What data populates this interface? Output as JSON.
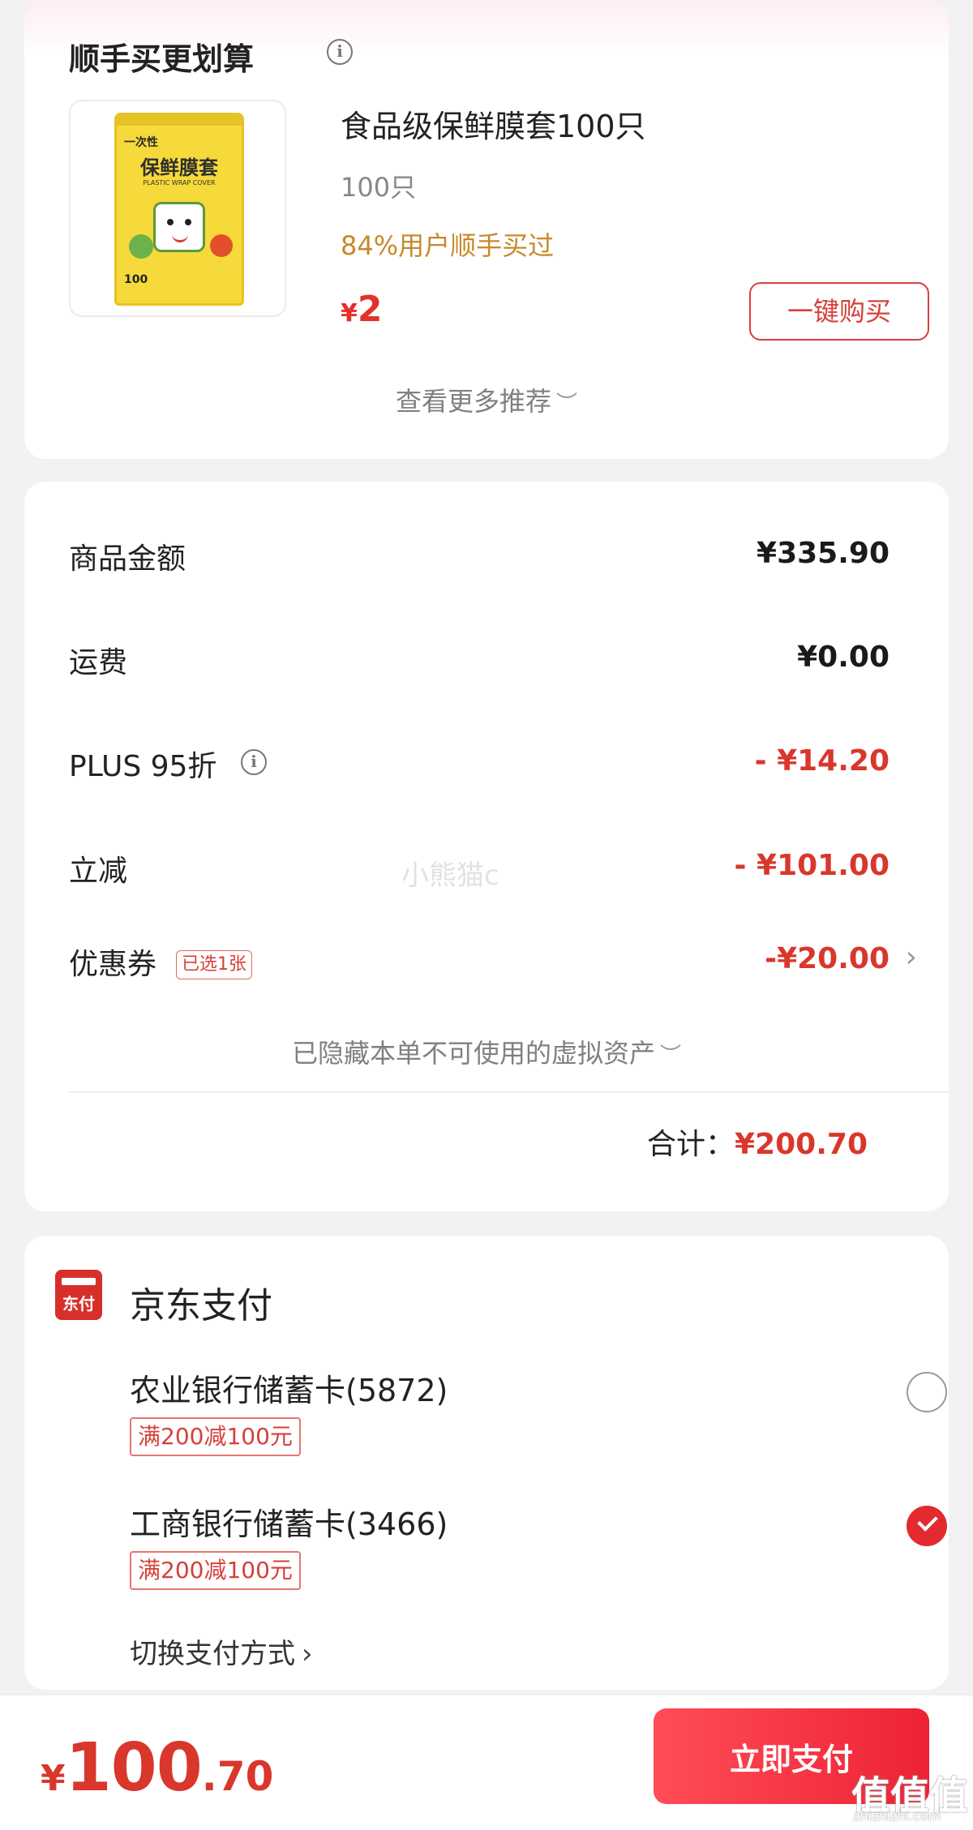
{
  "recommendation": {
    "title": "顺手买更划算",
    "product": {
      "image_package_brand": "一次性",
      "image_package_name": "保鲜膜套",
      "image_package_sub": "PLASTIC WRAP COVER",
      "image_package_count": "100",
      "name": "食品级保鲜膜套100只",
      "spec": "100只",
      "hint": "84%用户顺手买过",
      "price_currency": "¥",
      "price": "2",
      "buy_label": "一键购买"
    },
    "more_label": "查看更多推荐"
  },
  "summary": {
    "rows": [
      {
        "label": "商品金额",
        "value": "¥335.90"
      },
      {
        "label": "运费",
        "value": "¥0.00"
      },
      {
        "label": "PLUS 95折",
        "value": "- ¥14.20"
      },
      {
        "label": "立减",
        "value": "- ¥101.00"
      },
      {
        "label": "优惠券",
        "badge": "已选1张",
        "value": "-¥20.00"
      }
    ],
    "hidden_note": "已隐藏本单不可使用的虚拟资产",
    "total_label": "合计：",
    "total_value": "¥200.70",
    "watermark": "小熊猫c"
  },
  "payment": {
    "logo_text": "东付",
    "title": "京东支付",
    "cards": [
      {
        "name": "农业银行储蓄卡(5872)",
        "promo": "满200减100元",
        "selected": false
      },
      {
        "name": "工商银行储蓄卡(3466)",
        "promo": "满200减100元",
        "selected": true
      }
    ],
    "switch_label": "切换支付方式"
  },
  "bottom": {
    "currency": "¥",
    "price_int": "100",
    "price_dec": ".70",
    "pay_label": "立即支付",
    "watermark_site": "值值值",
    "watermark_url": "zhizhizhi.com"
  },
  "colors": {
    "accent_red": "#d9372c",
    "hint_orange": "#c8892a",
    "pay_button": "#ed2235"
  },
  "icons": [
    "info-icon",
    "chevron-down-icon",
    "chevron-right-icon",
    "jd-pay-logo-icon",
    "radio-unchecked-icon",
    "radio-checked-icon"
  ]
}
